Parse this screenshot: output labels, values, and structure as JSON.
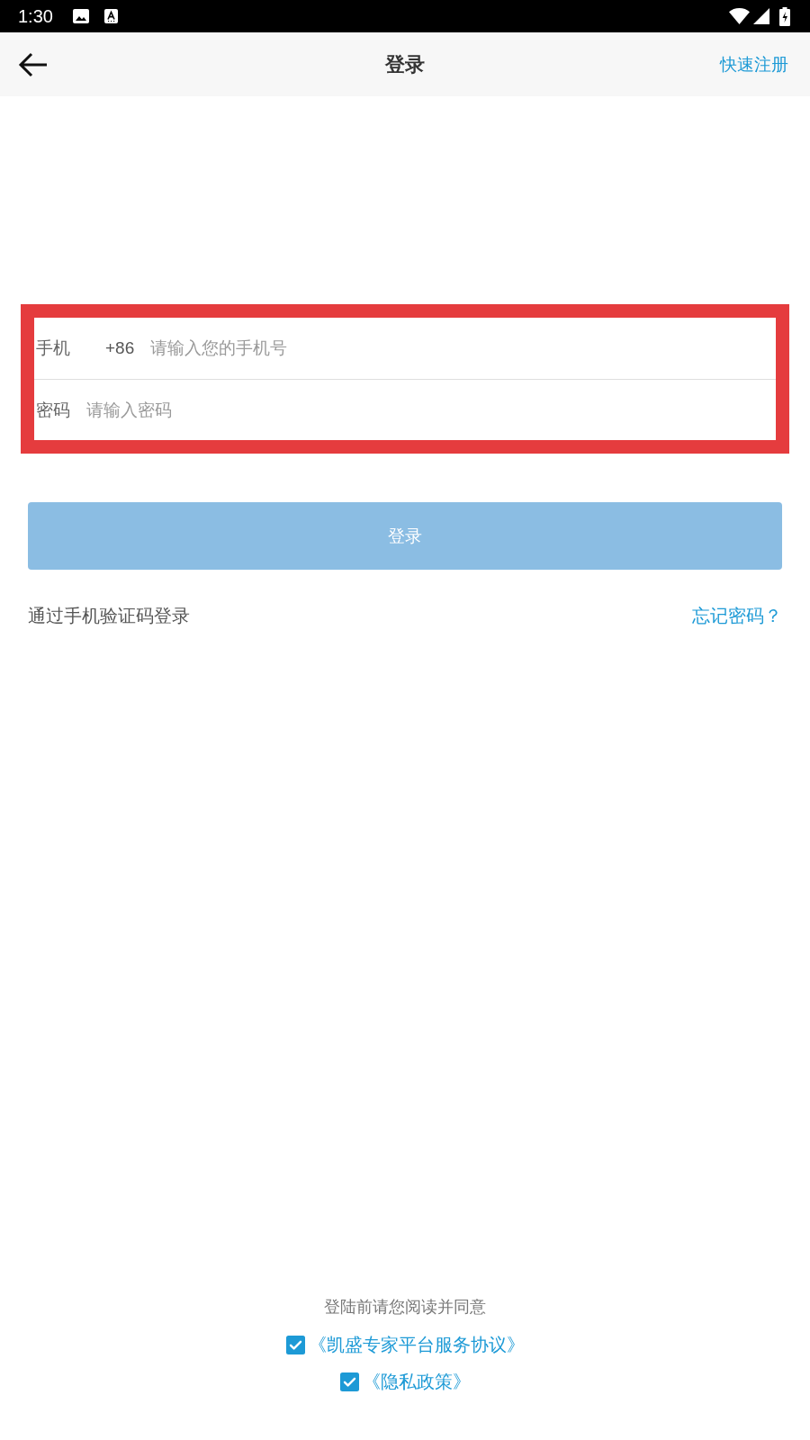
{
  "status_bar": {
    "time": "1:30"
  },
  "app_bar": {
    "title": "登录",
    "action": "快速注册"
  },
  "form": {
    "highlighted": true,
    "fields": [
      {
        "kind": "phone",
        "label": "手机",
        "prefix": "+86",
        "placeholder": "请输入您的手机号"
      },
      {
        "kind": "password",
        "label": "密码",
        "placeholder": "请输入密码"
      }
    ]
  },
  "login_button": {
    "label": "登录",
    "disabled": true
  },
  "links": {
    "sms_login": "通过手机验证码登录",
    "forgot_password": "忘记密码？"
  },
  "agreement": {
    "prompt": "登陆前请您阅读并同意",
    "items": [
      {
        "label": "《凯盛专家平台服务协议》",
        "checked": true
      },
      {
        "label": "《隐私政策》",
        "checked": true
      }
    ]
  }
}
